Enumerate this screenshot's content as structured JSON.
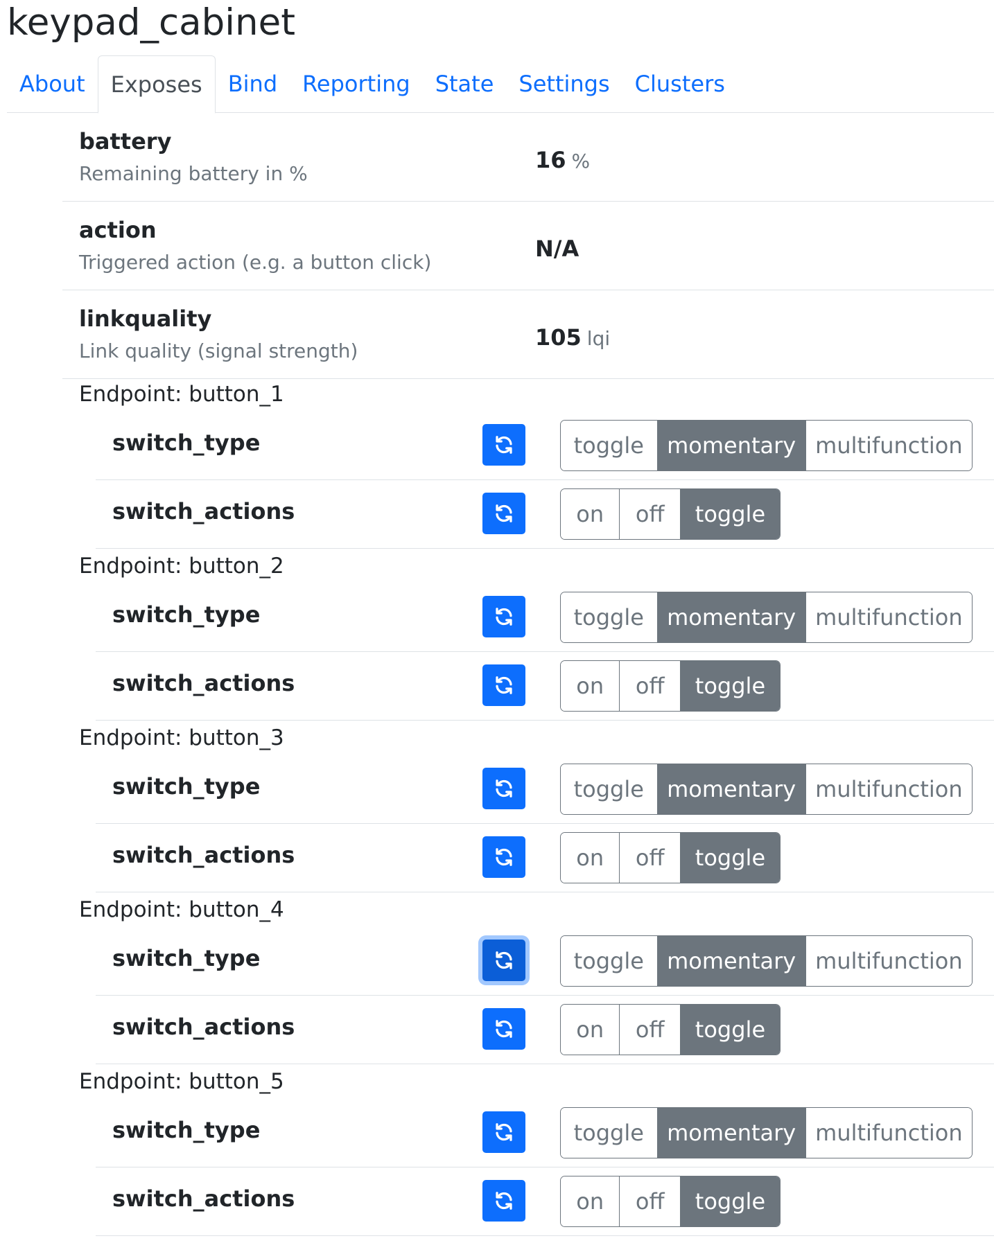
{
  "title": "keypad_cabinet",
  "tabs": [
    {
      "label": "About",
      "active": false
    },
    {
      "label": "Exposes",
      "active": true
    },
    {
      "label": "Bind",
      "active": false
    },
    {
      "label": "Reporting",
      "active": false
    },
    {
      "label": "State",
      "active": false
    },
    {
      "label": "Settings",
      "active": false
    },
    {
      "label": "Clusters",
      "active": false
    }
  ],
  "exposes": {
    "battery": {
      "name": "battery",
      "description": "Remaining battery in %",
      "value": "16",
      "unit": "%"
    },
    "action": {
      "name": "action",
      "description": "Triggered action (e.g. a button click)",
      "value": "N/A"
    },
    "linkquality": {
      "name": "linkquality",
      "description": "Link quality (signal strength)",
      "value": "105",
      "unit": "lqi"
    }
  },
  "colors": {
    "link": "#0d6efd",
    "primary": "#0d6efd",
    "secondary": "#6c757d",
    "muted_text": "#6c757d",
    "divider": "#dee2e6"
  },
  "icons": {
    "refresh": "refresh-icon"
  },
  "endpoints": [
    {
      "label": "Endpoint: button_1",
      "switch_type": {
        "name": "switch_type",
        "options": [
          "toggle",
          "momentary",
          "multifunction"
        ],
        "selected": "momentary"
      },
      "switch_actions": {
        "name": "switch_actions",
        "options": [
          "on",
          "off",
          "toggle"
        ],
        "selected": "toggle"
      }
    },
    {
      "label": "Endpoint: button_2",
      "switch_type": {
        "name": "switch_type",
        "options": [
          "toggle",
          "momentary",
          "multifunction"
        ],
        "selected": "momentary"
      },
      "switch_actions": {
        "name": "switch_actions",
        "options": [
          "on",
          "off",
          "toggle"
        ],
        "selected": "toggle"
      }
    },
    {
      "label": "Endpoint: button_3",
      "switch_type": {
        "name": "switch_type",
        "options": [
          "toggle",
          "momentary",
          "multifunction"
        ],
        "selected": "momentary"
      },
      "switch_actions": {
        "name": "switch_actions",
        "options": [
          "on",
          "off",
          "toggle"
        ],
        "selected": "toggle"
      }
    },
    {
      "label": "Endpoint: button_4",
      "switch_type": {
        "name": "switch_type",
        "options": [
          "toggle",
          "momentary",
          "multifunction"
        ],
        "selected": "momentary",
        "refresh_focused": true
      },
      "switch_actions": {
        "name": "switch_actions",
        "options": [
          "on",
          "off",
          "toggle"
        ],
        "selected": "toggle"
      }
    },
    {
      "label": "Endpoint: button_5",
      "switch_type": {
        "name": "switch_type",
        "options": [
          "toggle",
          "momentary",
          "multifunction"
        ],
        "selected": "momentary"
      },
      "switch_actions": {
        "name": "switch_actions",
        "options": [
          "on",
          "off",
          "toggle"
        ],
        "selected": "toggle"
      }
    }
  ]
}
